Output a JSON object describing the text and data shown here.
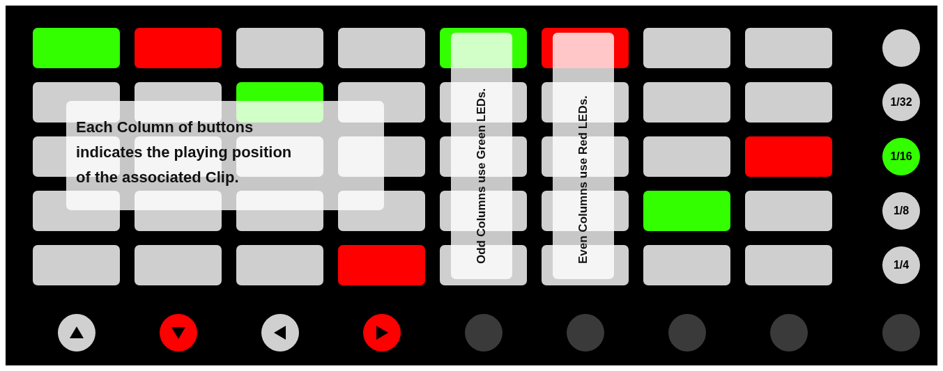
{
  "pads": [
    [
      {
        "color": "#33ff00"
      },
      {
        "color": "#ff0000"
      },
      {
        "color": "#cfcfcf"
      },
      {
        "color": "#cfcfcf"
      },
      {
        "color": "#33ff00"
      },
      {
        "color": "#ff0000"
      },
      {
        "color": "#cfcfcf"
      },
      {
        "color": "#cfcfcf"
      }
    ],
    [
      {
        "color": "#cfcfcf"
      },
      {
        "color": "#cfcfcf"
      },
      {
        "color": "#33ff00"
      },
      {
        "color": "#cfcfcf"
      },
      {
        "color": "#cfcfcf"
      },
      {
        "color": "#cfcfcf"
      },
      {
        "color": "#cfcfcf"
      },
      {
        "color": "#cfcfcf"
      }
    ],
    [
      {
        "color": "#cfcfcf"
      },
      {
        "color": "#cfcfcf"
      },
      {
        "color": "#cfcfcf"
      },
      {
        "color": "#cfcfcf"
      },
      {
        "color": "#cfcfcf"
      },
      {
        "color": "#cfcfcf"
      },
      {
        "color": "#cfcfcf"
      },
      {
        "color": "#ff0000"
      }
    ],
    [
      {
        "color": "#cfcfcf"
      },
      {
        "color": "#cfcfcf"
      },
      {
        "color": "#cfcfcf"
      },
      {
        "color": "#cfcfcf"
      },
      {
        "color": "#cfcfcf"
      },
      {
        "color": "#cfcfcf"
      },
      {
        "color": "#33ff00"
      },
      {
        "color": "#cfcfcf"
      }
    ],
    [
      {
        "color": "#cfcfcf"
      },
      {
        "color": "#cfcfcf"
      },
      {
        "color": "#cfcfcf"
      },
      {
        "color": "#ff0000"
      },
      {
        "color": "#cfcfcf"
      },
      {
        "color": "#cfcfcf"
      },
      {
        "color": "#cfcfcf"
      },
      {
        "color": "#cfcfcf"
      }
    ]
  ],
  "scene_buttons": [
    {
      "selected": false
    },
    {
      "label": "1/32",
      "selected": false
    },
    {
      "label": "1/16",
      "selected": true
    },
    {
      "label": "1/8",
      "selected": false
    },
    {
      "label": "1/4",
      "selected": false
    }
  ],
  "nav_buttons": [
    {
      "kind": "up",
      "color": "#d0d0d0"
    },
    {
      "kind": "down",
      "color": "#ff0000"
    },
    {
      "kind": "left",
      "color": "#d0d0d0"
    },
    {
      "kind": "right",
      "color": "#ff0000"
    },
    {
      "kind": "plain",
      "color": "#3a3a3a"
    },
    {
      "kind": "plain",
      "color": "#3a3a3a"
    },
    {
      "kind": "plain",
      "color": "#3a3a3a"
    },
    {
      "kind": "plain",
      "color": "#3a3a3a"
    },
    {
      "kind": "plain",
      "color": "#3a3a3a"
    }
  ],
  "notes": [
    {
      "kind": "horizontal",
      "lines": [
        "Each Column of buttons",
        "indicates the playing position",
        "of the associated Clip."
      ]
    },
    {
      "kind": "vertical",
      "lines": [
        "Odd Columns use Green LEDs."
      ]
    },
    {
      "kind": "vertical",
      "lines": [
        "Even Columns use Red LEDs."
      ]
    }
  ]
}
